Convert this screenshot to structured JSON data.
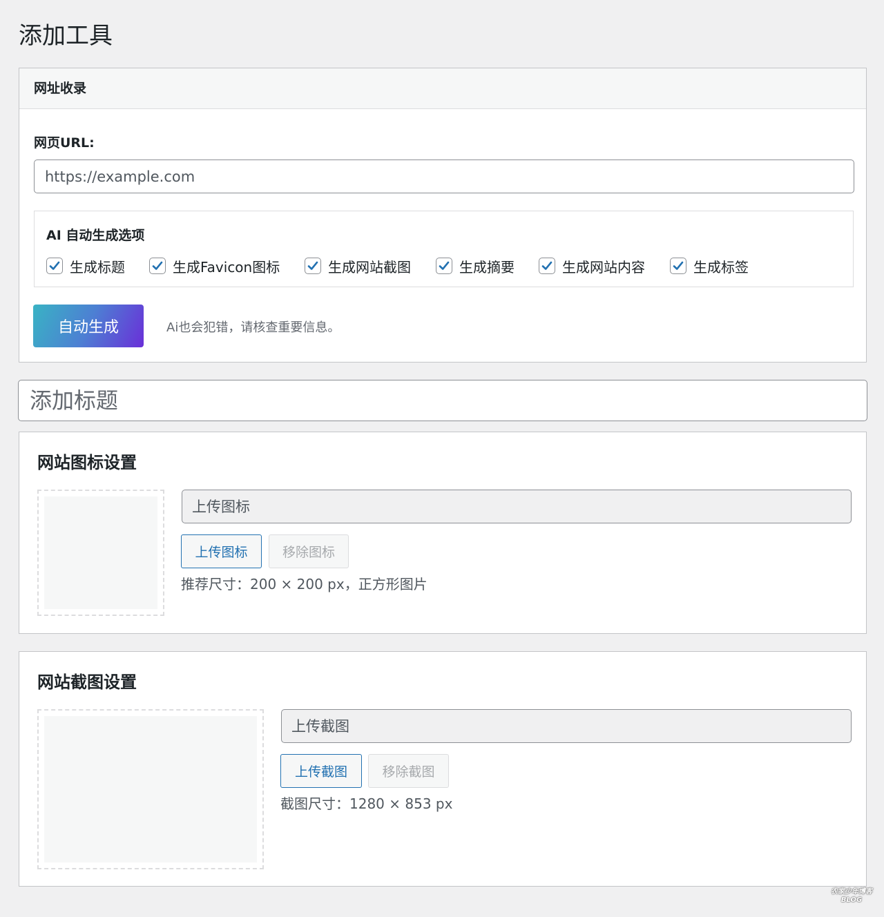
{
  "page": {
    "title": "添加工具"
  },
  "url_panel": {
    "header": "网址收录",
    "url_label": "网页URL:",
    "url_placeholder": "https://example.com",
    "ai_options_title": "AI 自动生成选项",
    "options": [
      {
        "label": "生成标题",
        "checked": true
      },
      {
        "label": "生成Favicon图标",
        "checked": true
      },
      {
        "label": "生成网站截图",
        "checked": true
      },
      {
        "label": "生成摘要",
        "checked": true
      },
      {
        "label": "生成网站内容",
        "checked": true
      },
      {
        "label": "生成标签",
        "checked": true
      }
    ],
    "generate_button": "自动生成",
    "ai_note": "Ai也会犯错，请核查重要信息。",
    "gradient_colors": [
      "#39b3c4",
      "#4d7fd3",
      "#6a2fd8"
    ]
  },
  "title_field": {
    "placeholder": "添加标题"
  },
  "icon_section": {
    "title": "网站图标设置",
    "field_placeholder": "上传图标",
    "upload_button": "上传图标",
    "remove_button": "移除图标",
    "hint": "推荐尺寸：200 × 200 px，正方形图片"
  },
  "screenshot_section": {
    "title": "网站截图设置",
    "field_placeholder": "上传截图",
    "upload_button": "上传截图",
    "remove_button": "移除截图",
    "hint": "截图尺寸：1280 × 853 px"
  },
  "watermark": {
    "line1": "农家少年博客",
    "line2": "BLOG"
  },
  "colors": {
    "accent": "#2271b1",
    "background": "#f0f0f1",
    "checkmark": "#2271b1"
  }
}
